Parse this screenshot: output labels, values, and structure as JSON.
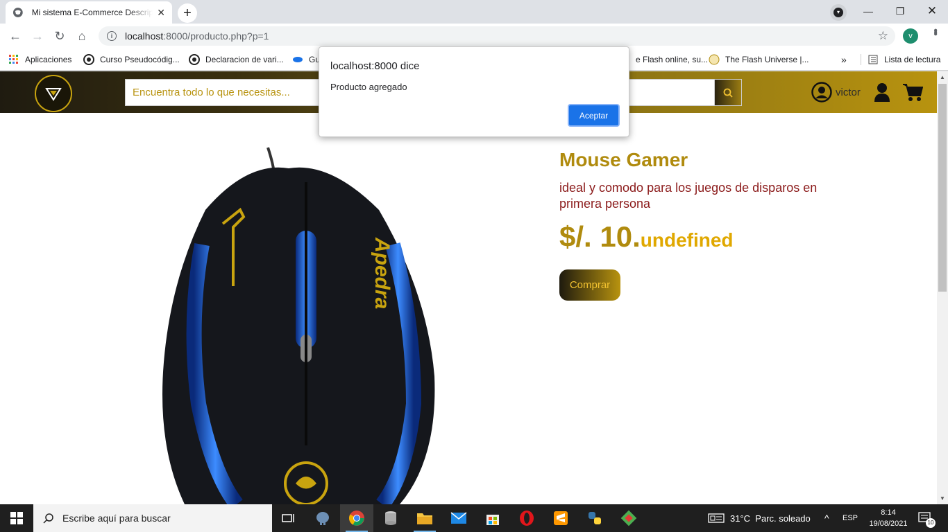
{
  "browser": {
    "tab_title": "Mi sistema E-Commerce Descripción",
    "address_host": "localhost",
    "address_path": ":8000/producto.php?p=1",
    "profile_initial": "v",
    "bookmarks": [
      "Aplicaciones",
      "Curso Pseudocódig...",
      "Declaracion de vari...",
      "Gu",
      "e Flash online, su...",
      "The Flash Universe |...",
      "Lista de lectura"
    ]
  },
  "site": {
    "search_placeholder": "Encuentra todo lo que necesitas...",
    "username": "victor"
  },
  "product": {
    "title": "Mouse Gamer",
    "description": "ideal y comodo para los juegos de disparos en primera persona",
    "price_main": "$/. 10.",
    "price_decimal": "undefined",
    "buy_label": "Comprar",
    "image_brand_text": "Apedra"
  },
  "dialog": {
    "origin": "localhost:8000 dice",
    "message": "Producto agregado",
    "ok_label": "Aceptar"
  },
  "taskbar": {
    "search_placeholder": "Escribe aquí para buscar",
    "weather": "31°C  Parc. soleado",
    "language": "ESP",
    "time": "8:14",
    "date": "19/08/2021",
    "notifications": "10"
  },
  "colors": {
    "brand_gold": "#b08b0e",
    "header_dark": "#1f1b10",
    "description_red": "#8b1a1a",
    "dialog_button": "#1a73e8"
  }
}
